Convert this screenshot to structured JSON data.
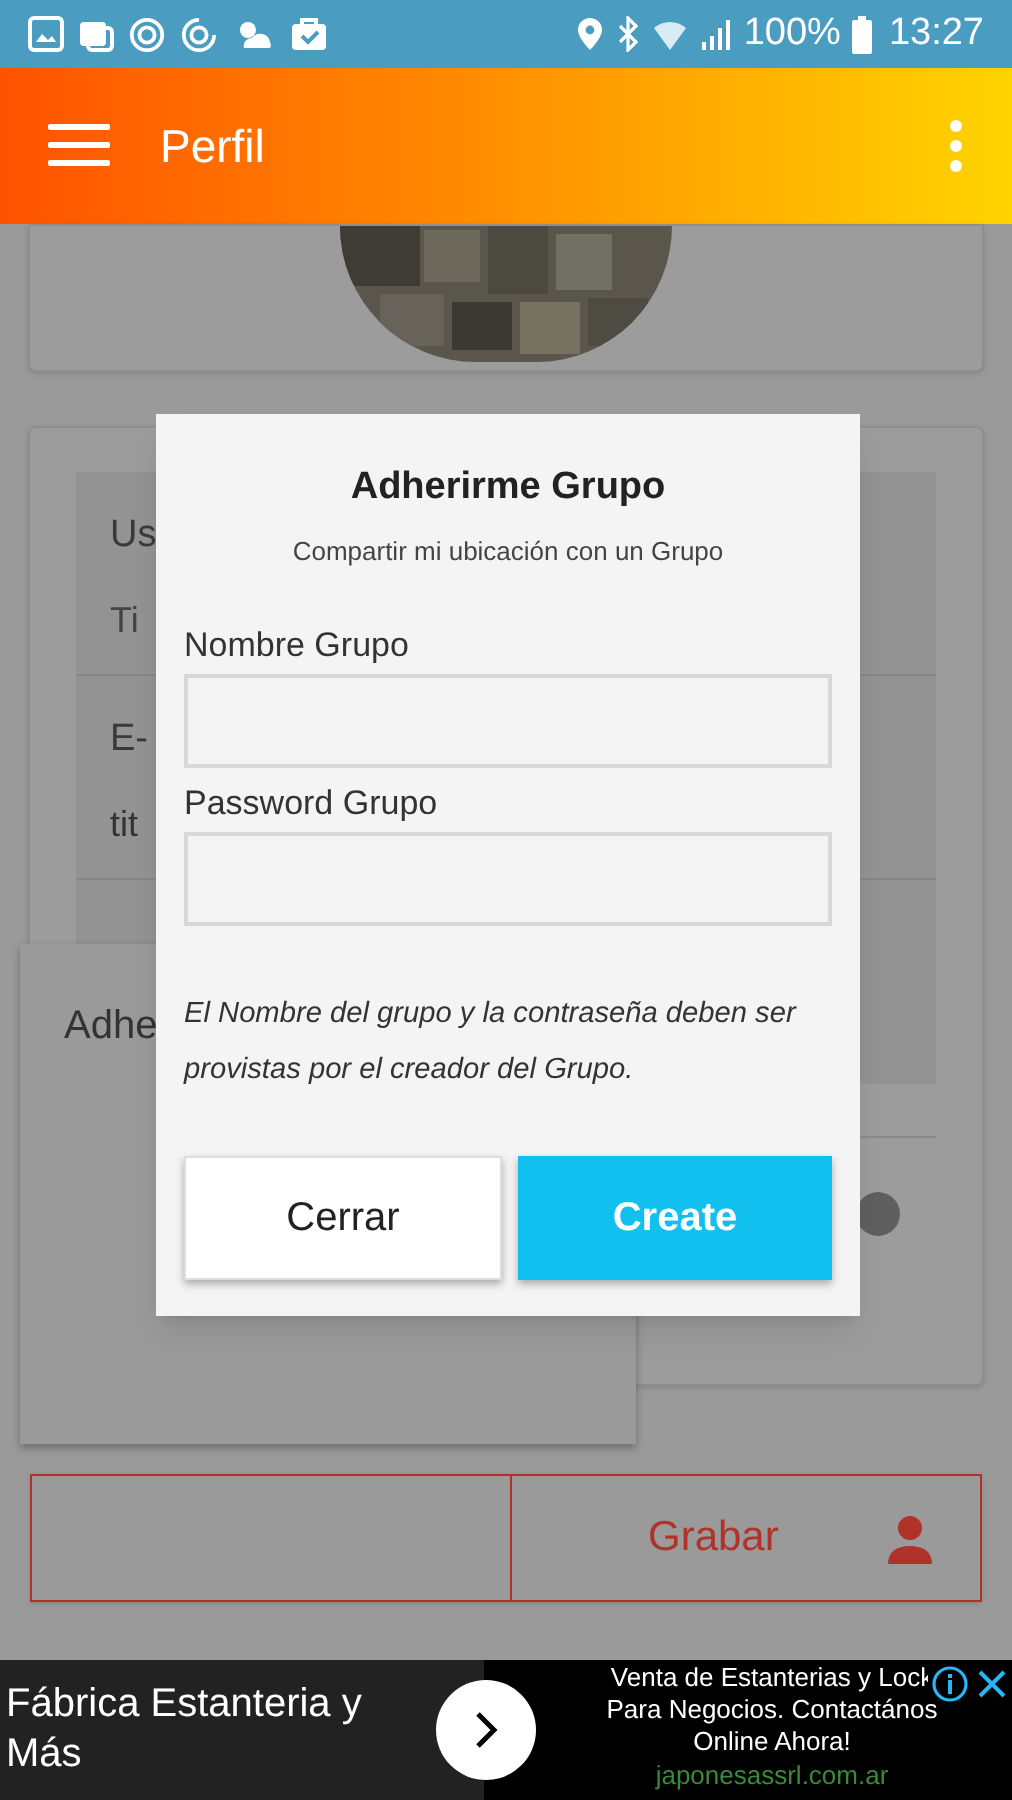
{
  "status_bar": {
    "battery": "100%",
    "time": "13:27"
  },
  "app_bar": {
    "title": "Perfil"
  },
  "background": {
    "user_label": "Us",
    "user_value": "Ti",
    "email_label": "E-",
    "email_value": "tit",
    "panel_label": "Adhe",
    "save_button": "Grabar"
  },
  "dialog": {
    "title": "Adherirme Grupo",
    "subtitle": "Compartir mi ubicación con un Grupo",
    "fields": [
      {
        "label": "Nombre Grupo"
      },
      {
        "label": "Password Grupo"
      }
    ],
    "note": "El Nombre del grupo y la contraseña deben ser provistas por el creador del Grupo.",
    "buttons": [
      {
        "label": "Cerrar",
        "kind": "secondary"
      },
      {
        "label": "Create",
        "kind": "primary"
      }
    ]
  },
  "ad": {
    "headline": "Fábrica Estanteria y Más",
    "lines": [
      "Venta de Estanterias y Lock",
      "Para Negocios. Contactános",
      "Online Ahora!"
    ],
    "domain": "japonesassrl.com.ar"
  }
}
